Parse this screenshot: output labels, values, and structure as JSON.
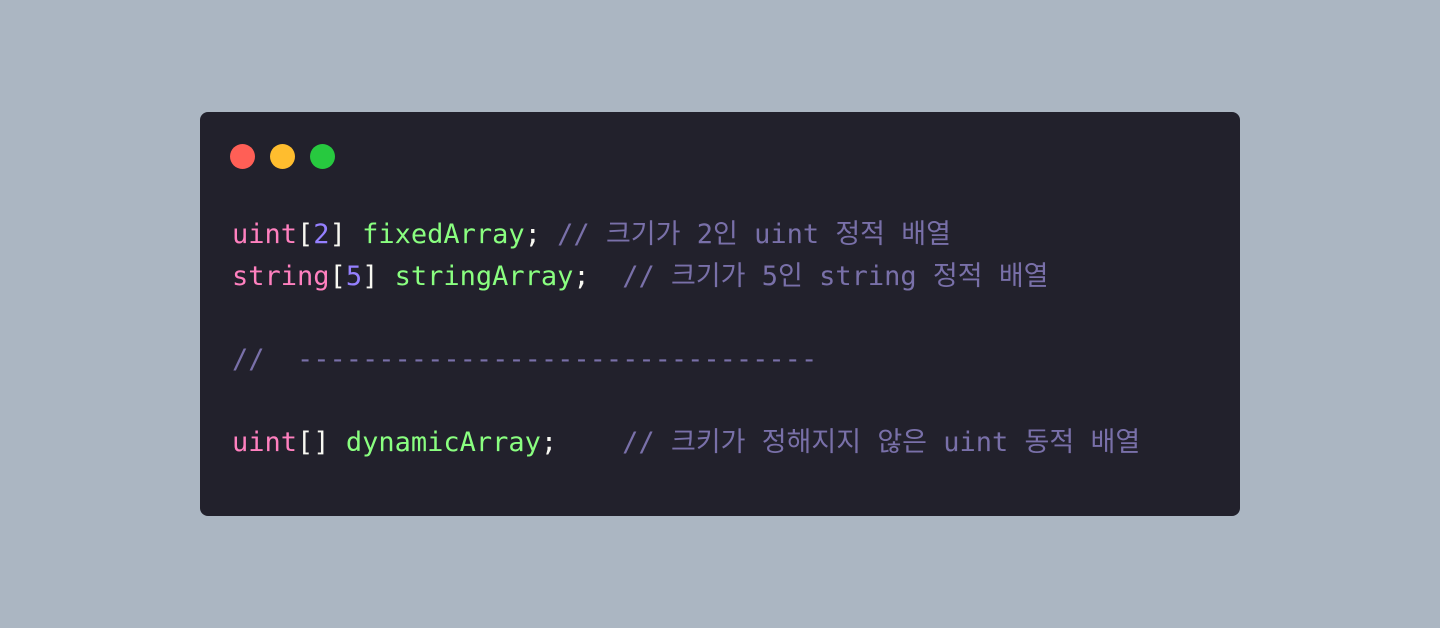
{
  "window": {
    "controls": {
      "close_color": "#ff5f56",
      "minimize_color": "#ffbd2e",
      "maximize_color": "#27c93f"
    }
  },
  "colors": {
    "background": "#abb6c2",
    "editor": "#22212c",
    "keyword": "#ff80bf",
    "number": "#9580ff",
    "identifier": "#8aff80",
    "comment": "#7970a9",
    "text": "#f8f8f2"
  },
  "code": {
    "line1": {
      "type": "uint",
      "open": "[",
      "size": "2",
      "close": "]",
      "space": " ",
      "name": "fixedArray",
      "end": "; ",
      "comment": "// 크기가 2인 uint 정적 배열"
    },
    "line2": {
      "type": "string",
      "open": "[",
      "size": "5",
      "close": "]",
      "space": " ",
      "name": "stringArray",
      "end": ";  ",
      "comment": "// 크기가 5인 string 정적 배열"
    },
    "line3": "",
    "line4": {
      "comment": "//  --------------------------------"
    },
    "line5": "",
    "line6": {
      "type": "uint",
      "brackets": "[]",
      "space": " ",
      "name": "dynamicArray",
      "end": ";    ",
      "comment": "// 크키가 정해지지 않은 uint 동적 배열"
    }
  }
}
